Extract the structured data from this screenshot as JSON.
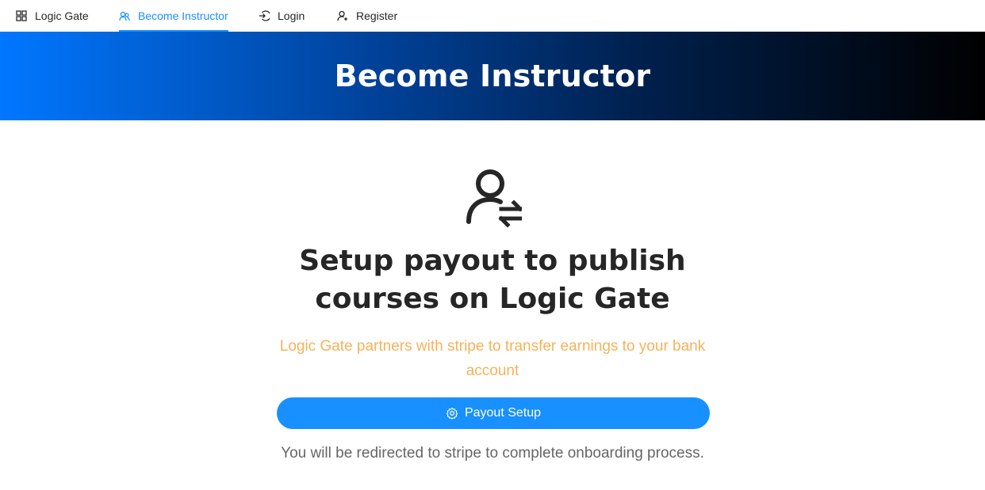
{
  "nav": {
    "items": [
      {
        "label": "Logic Gate",
        "icon": "app-grid-icon"
      },
      {
        "label": "Become Instructor",
        "icon": "team-icon",
        "active": true
      },
      {
        "label": "Login",
        "icon": "login-icon"
      },
      {
        "label": "Register",
        "icon": "user-add-icon"
      }
    ]
  },
  "hero": {
    "title": "Become Instructor"
  },
  "main": {
    "icon": "user-switch-icon",
    "title_line1": "Setup payout to publish",
    "title_line2": "courses on Logic Gate",
    "subtitle": "Logic Gate partners with stripe to transfer earnings to your bank account",
    "button_label": "Payout Setup",
    "button_icon": "setting-icon",
    "note": "You will be redirected to stripe to complete onboarding process."
  },
  "colors": {
    "accent": "#1890ff",
    "subtitle": "#f5b35a",
    "hero_start": "#0077ff",
    "hero_end": "#000000"
  }
}
